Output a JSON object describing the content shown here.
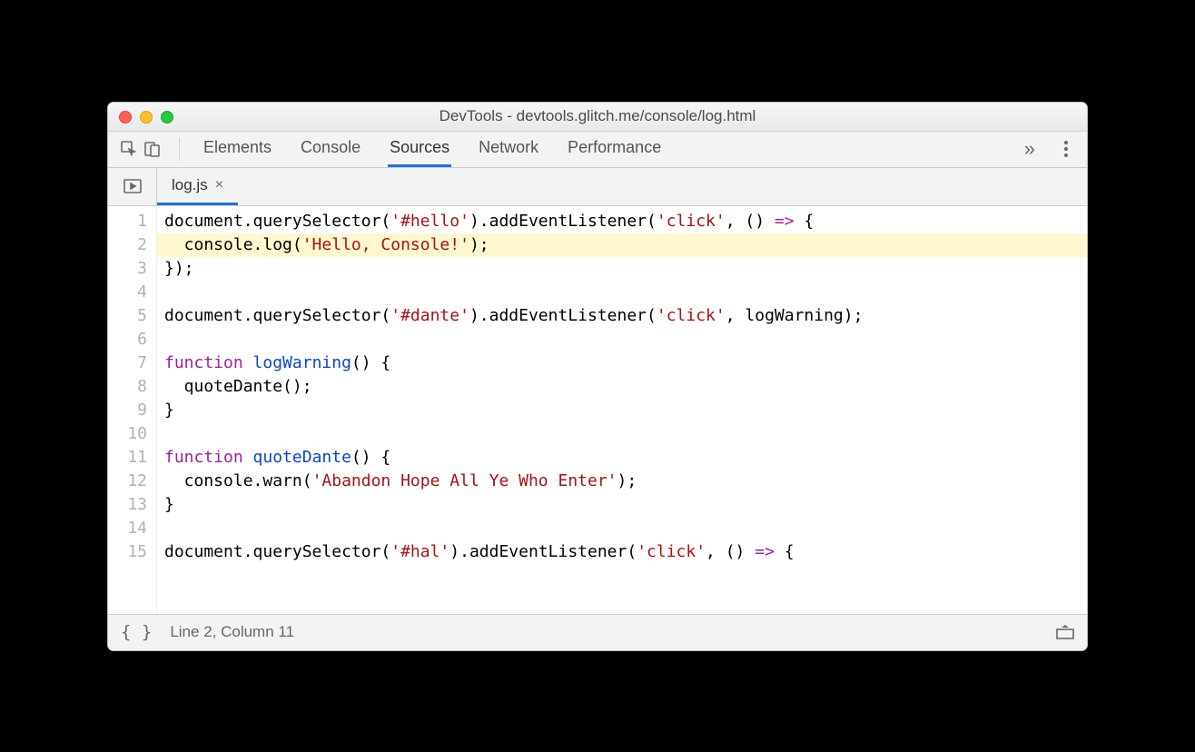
{
  "window": {
    "title": "DevTools - devtools.glitch.me/console/log.html"
  },
  "panels": {
    "elements": "Elements",
    "console": "Console",
    "sources": "Sources",
    "network": "Network",
    "performance": "Performance",
    "more_glyph": "»",
    "active": "sources"
  },
  "sources": {
    "open_file": "log.js",
    "close_glyph": "×",
    "highlighted_line": 2,
    "code_lines": [
      [
        {
          "t": "document.querySelector("
        },
        {
          "t": "'#hello'",
          "c": "str"
        },
        {
          "t": ").addEventListener("
        },
        {
          "t": "'click'",
          "c": "str"
        },
        {
          "t": ", () "
        },
        {
          "t": "=>",
          "c": "kw"
        },
        {
          "t": " {"
        }
      ],
      [
        {
          "t": "  console.log("
        },
        {
          "t": "'Hello, Console!'",
          "c": "str"
        },
        {
          "t": ");"
        }
      ],
      [
        {
          "t": "});"
        }
      ],
      [],
      [
        {
          "t": "document.querySelector("
        },
        {
          "t": "'#dante'",
          "c": "str"
        },
        {
          "t": ").addEventListener("
        },
        {
          "t": "'click'",
          "c": "str"
        },
        {
          "t": ", logWarning);"
        }
      ],
      [],
      [
        {
          "t": "function ",
          "c": "kw"
        },
        {
          "t": "logWarning",
          "c": "def"
        },
        {
          "t": "() {"
        }
      ],
      [
        {
          "t": "  quoteDante();"
        }
      ],
      [
        {
          "t": "}"
        }
      ],
      [],
      [
        {
          "t": "function ",
          "c": "kw"
        },
        {
          "t": "quoteDante",
          "c": "def"
        },
        {
          "t": "() {"
        }
      ],
      [
        {
          "t": "  console.warn("
        },
        {
          "t": "'Abandon Hope All Ye Who Enter'",
          "c": "str"
        },
        {
          "t": ");"
        }
      ],
      [
        {
          "t": "}"
        }
      ],
      [],
      [
        {
          "t": "document.querySelector("
        },
        {
          "t": "'#hal'",
          "c": "str"
        },
        {
          "t": ").addEventListener("
        },
        {
          "t": "'click'",
          "c": "str"
        },
        {
          "t": ", () "
        },
        {
          "t": "=>",
          "c": "kw"
        },
        {
          "t": " {"
        }
      ]
    ]
  },
  "status": {
    "braces": "{ }",
    "cursor": "Line 2, Column 11"
  }
}
